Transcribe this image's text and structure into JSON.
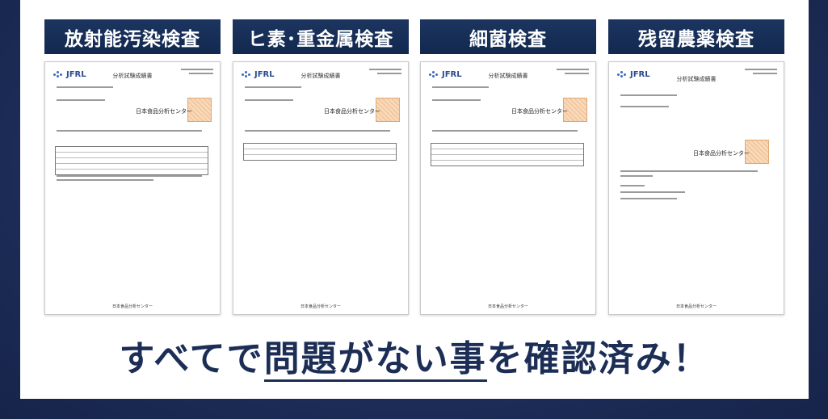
{
  "cards": [
    {
      "title": "放射能汚染検査"
    },
    {
      "title": "ヒ素･重金属検査"
    },
    {
      "title": "細菌検査"
    },
    {
      "title": "残留農薬検査"
    }
  ],
  "document": {
    "logo_text": "JFRL",
    "doc_title": "分析試験成績書",
    "center_name": "日本食品分析センター",
    "footer": "日本食品分析センター"
  },
  "caption": {
    "part1": "すべてで",
    "part2": "問題がない事",
    "part3": "を確認済み！"
  },
  "colors": {
    "header_bg": "#12284f",
    "caption": "#1c2e56",
    "background": "#1b2b55"
  }
}
